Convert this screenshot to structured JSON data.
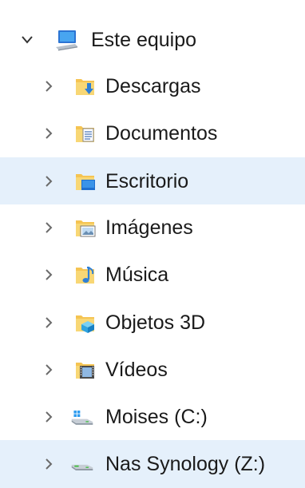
{
  "nav_tree": {
    "root": {
      "label": "Este equipo",
      "icon": "computer-icon",
      "expanded": true
    },
    "items": [
      {
        "label": "Descargas",
        "icon": "downloads-folder-icon",
        "selected": false
      },
      {
        "label": "Documentos",
        "icon": "documents-folder-icon",
        "selected": false
      },
      {
        "label": "Escritorio",
        "icon": "desktop-folder-icon",
        "selected": true
      },
      {
        "label": "Imágenes",
        "icon": "pictures-folder-icon",
        "selected": false
      },
      {
        "label": "Música",
        "icon": "music-folder-icon",
        "selected": false
      },
      {
        "label": "Objetos 3D",
        "icon": "3d-objects-folder-icon",
        "selected": false
      },
      {
        "label": "Vídeos",
        "icon": "videos-folder-icon",
        "selected": false
      },
      {
        "label": "Moises (C:)",
        "icon": "windows-drive-icon",
        "selected": false
      },
      {
        "label": "Nas Synology (Z:)",
        "icon": "network-drive-icon",
        "selected": true
      }
    ]
  },
  "colors": {
    "selection": "#e5f0fb",
    "folder": "#f5c452",
    "accent": "#2e7fd6",
    "chevron": "#6b6b6b"
  }
}
